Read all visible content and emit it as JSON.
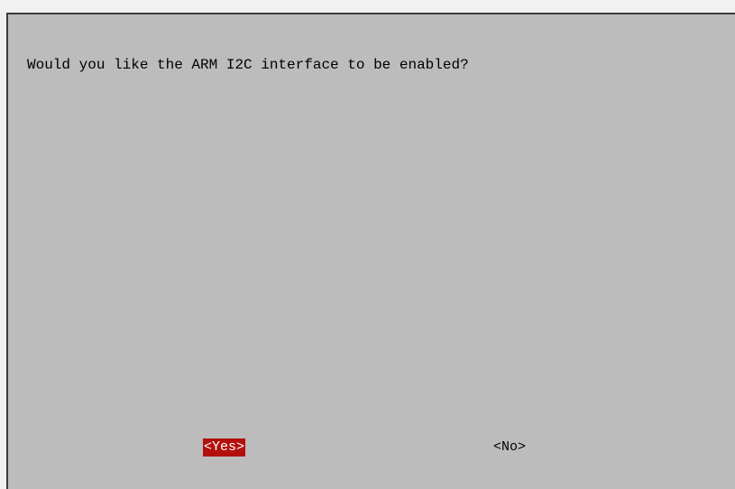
{
  "dialog": {
    "message": "Would you like the ARM I2C interface to be enabled?",
    "buttons": {
      "yes": "<Yes>",
      "no": "<No>"
    },
    "selected": "yes"
  },
  "colors": {
    "background": "#bcbcbc",
    "selected_button": "#b3100d",
    "selected_text": "#ffffff",
    "text": "#000000"
  }
}
